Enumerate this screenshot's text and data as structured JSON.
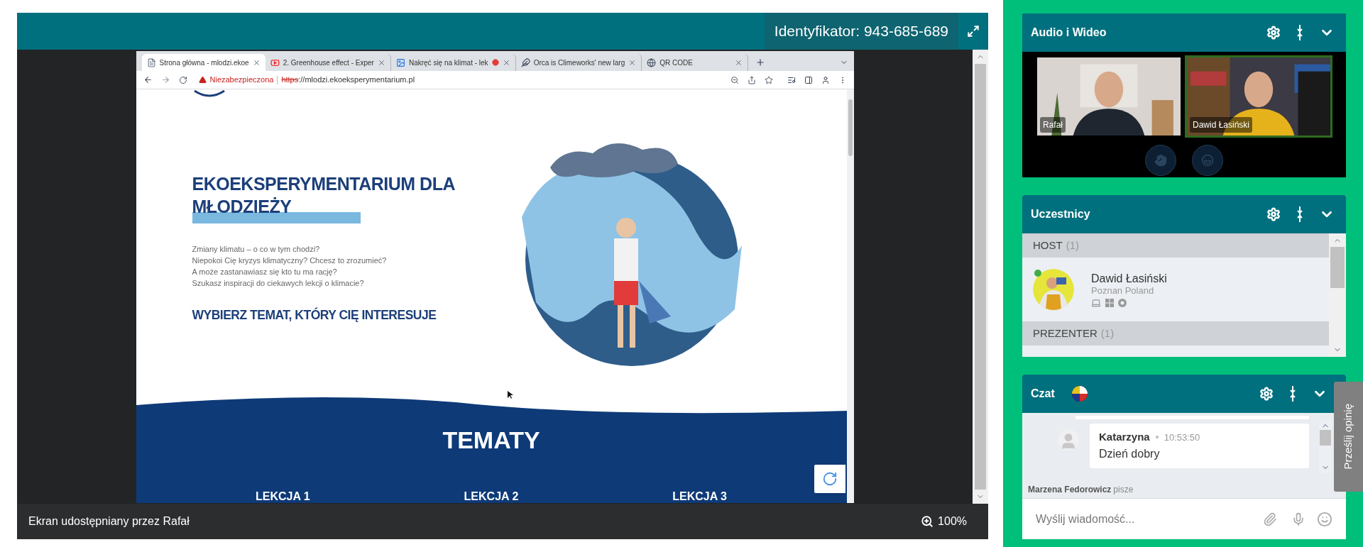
{
  "meeting": {
    "id_label": "Identyfikator: 943-685-689",
    "share_caption": "Ekran udostępniany przez Rafał",
    "zoom": "100%"
  },
  "browser": {
    "tabs": [
      {
        "title": "Strona główna - mlodzi.ekoe",
        "selected": true,
        "kind": "page",
        "recording": false
      },
      {
        "title": "2. Greenhouse effect - Exper",
        "selected": false,
        "kind": "video",
        "recording": false
      },
      {
        "title": "Nakręć się na klimat - lek",
        "selected": false,
        "kind": "app",
        "recording": true
      },
      {
        "title": "Orca is Climeworks' new larg",
        "selected": false,
        "kind": "bird",
        "recording": false
      },
      {
        "title": "QR CODE",
        "selected": false,
        "kind": "globe",
        "recording": false
      }
    ],
    "security": "Niezabezpieczona",
    "url_scheme": "https",
    "url_rest": "://mlodzi.ekoeksperymentarium.pl"
  },
  "page": {
    "heading": "EKOEKSPERYMENTARIUM DLA MŁODZIEŻY",
    "intro": [
      "Zmiany klimatu – o co w tym chodzi?",
      "Niepokoi Cię kryzys klimatyczny? Chcesz to zrozumieć?",
      "A może zastanawiasz się kto tu ma rację?",
      "Szukasz inspiracji do ciekawych lekcji o klimacie?"
    ],
    "cta": "WYBIERZ TEMAT, KTÓRY CIĘ INTERESUJE",
    "section_title": "TEMATY",
    "lessons": [
      "LEKCJA 1",
      "LEKCJA 2",
      "LEKCJA 3"
    ]
  },
  "audio_video": {
    "title": "Audio i Wideo",
    "videos": [
      {
        "name": "Rafał",
        "speaking": false
      },
      {
        "name": "Dawid Łasiński",
        "speaking": true
      }
    ]
  },
  "participants": {
    "title": "Uczestnicy",
    "groups": [
      {
        "label": "HOST",
        "count": "(1)",
        "members": [
          {
            "name": "Dawid Łasiński",
            "location": "Poznan Poland",
            "online": true
          }
        ]
      },
      {
        "label": "PREZENTER",
        "count": "(1)"
      }
    ]
  },
  "chat": {
    "title": "Czat",
    "messages": [
      {
        "author": "Katarzyna",
        "time": "10:53:50",
        "text": "Dzień dobry"
      }
    ],
    "typing_name": "Marzena Fedorowicz",
    "typing_suffix": "pisze",
    "placeholder": "Wyślij wiadomość..."
  },
  "feedback": "Prześlij opinię"
}
